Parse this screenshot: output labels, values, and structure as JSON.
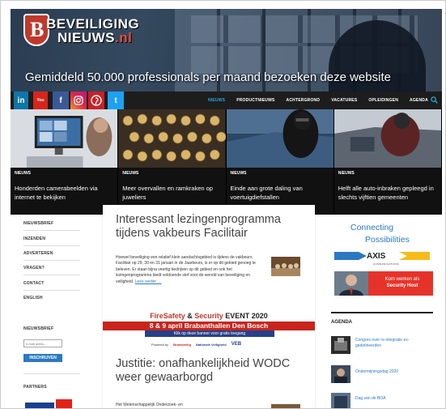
{
  "header": {
    "logo_line1": "BEVEILIGING",
    "logo_line2": "NIEUWS",
    "logo_suffix": ".nl",
    "logo_letter": "B",
    "tagline": "Gemiddeld 50.000 professionals per maand bezoeken deze website"
  },
  "social": {
    "linkedin": "in",
    "youtube": "You",
    "facebook": "f",
    "twitter": "t"
  },
  "nav": {
    "items": [
      "NIEUWS",
      "PRODUCTNIEUWS",
      "ACHTERGROND",
      "VACATURES",
      "OPLEIDINGEN",
      "AGENDA"
    ]
  },
  "tiles": [
    {
      "tag": "NIEUWS",
      "title": "Honderden camerabeelden via internet te bekijken"
    },
    {
      "tag": "NIEUWS",
      "title": "Meer overvallen en ramkraken op juweliers"
    },
    {
      "tag": "NIEUWS",
      "title": "Einde aan grote daling van voertuigdiefstallen"
    },
    {
      "tag": "NIEUWS",
      "title": "Helft alle auto-inbraken gepleegd in slechts vijftien gemeenten"
    }
  ],
  "left_sidebar": {
    "links": [
      "NIEUWSBRIEF",
      "INZENDEN",
      "ADVERTEREN",
      "VRAGEN?",
      "CONTACT",
      "ENGLISH"
    ],
    "newsletter_heading": "NIEUWSBRIEF",
    "email_placeholder": "e-mail adres...",
    "subscribe_label": "INSCHRIJVEN",
    "partners_heading": "PARTNERS",
    "partner_logo": "kiwa"
  },
  "articles": [
    {
      "title": "Interessant lezingenprogramma tijdens vakbeurs Facilitair",
      "body": "Hoewel beveiliging een relatief klein aandachtsgebied is tijdens de vakbeurs Facilitair op 29, 30 en 31 januari in de Jaarbeurs, is er op dit gebied genoeg te beleven. Er staan bijna veertig bedrijven op dit gebied en ook het lezingenprogramma biedt voldoende stof voor de wereld van beveiliging en veiligheid.",
      "read_more": "Lees verder →"
    },
    {
      "title": "Justitie: onafhankelijkheid WODC weer gewaarborgd",
      "body": "Het Wetenschappelijk Onderzoek- en"
    }
  ],
  "banner": {
    "brand1": "FireSafety",
    "amp": " & ",
    "brand2": "Security",
    "event": " EVENT 2020",
    "dates": "8 & 9 april Brabanthallen Den Bosch",
    "cta": "Klik op deze banner voor gratis toegang",
    "powered": "Powered by",
    "partners": [
      "Brandveilig",
      "Nationale Veiligheid",
      "VEB"
    ]
  },
  "right_sidebar": {
    "axis_ad_line1": "Connecting",
    "axis_ad_line2": "Possibilities",
    "axis_logo": "AXIS",
    "axis_sub": "COMMUNICATIONS",
    "host_ad_line1": "Kom werken als",
    "host_ad_line2": "Security Host",
    "agenda_heading": "AGENDA",
    "agenda_items": [
      "Congres over re-integratie ex-gedetineerden",
      "Ondermijningsdag 2020",
      "Dag van de BOA"
    ]
  },
  "colors": {
    "accent_blue": "#2b78c2",
    "nav_active": "#29a8e0",
    "banner_red": "#c8251c",
    "logo_red": "#c0392b"
  }
}
